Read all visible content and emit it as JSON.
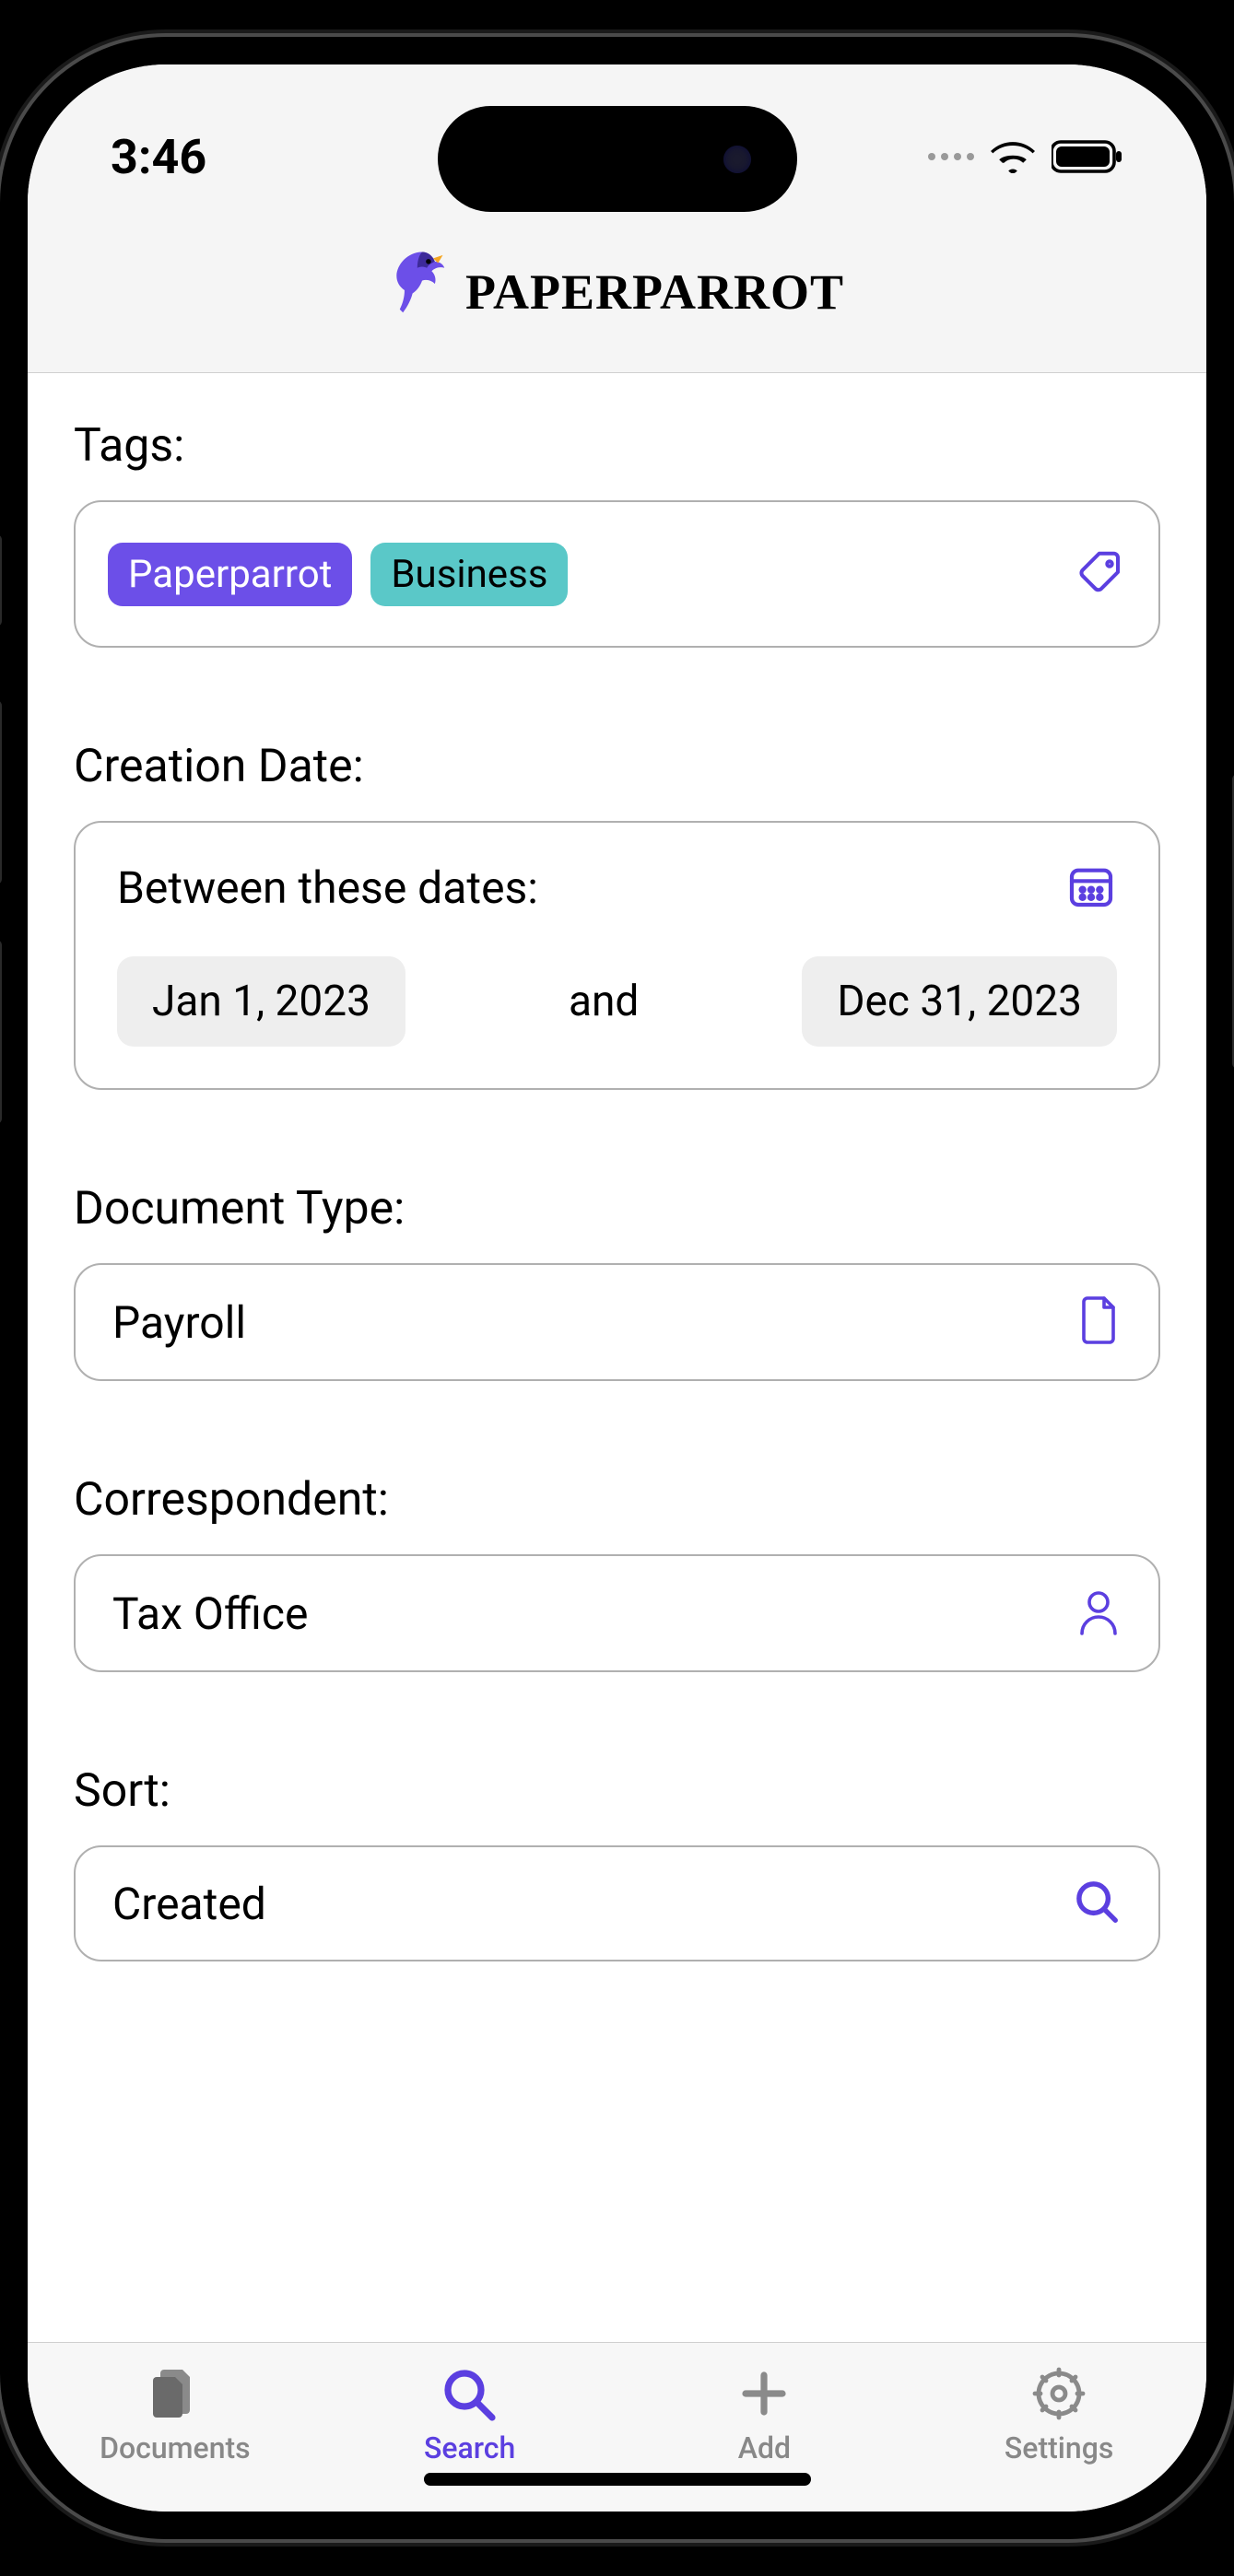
{
  "status": {
    "time": "3:46"
  },
  "header": {
    "title": "PAPERPARROT"
  },
  "sections": {
    "tags_label": "Tags:",
    "creation_label": "Creation Date:",
    "doctype_label": "Document Type:",
    "correspondent_label": "Correspondent:",
    "sort_label": "Sort:"
  },
  "tags": {
    "items": [
      {
        "label": "Paperparrot",
        "color": "purple"
      },
      {
        "label": "Business",
        "color": "teal"
      }
    ]
  },
  "date": {
    "header": "Between these dates:",
    "from": "Jan 1, 2023",
    "to": "Dec 31, 2023",
    "conjunction": "and"
  },
  "doctype": {
    "value": "Payroll"
  },
  "correspondent": {
    "value": "Tax Office"
  },
  "sort": {
    "value": "Created"
  },
  "tabs": {
    "documents": "Documents",
    "search": "Search",
    "add": "Add",
    "settings": "Settings"
  },
  "colors": {
    "accent": "#5b3fe0",
    "tag_purple": "#6c4fe8",
    "tag_teal": "#5ac8c8"
  }
}
